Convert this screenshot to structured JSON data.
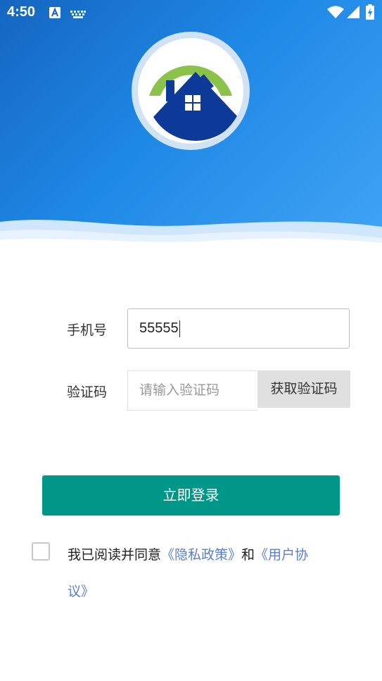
{
  "status_bar": {
    "time": "4:50",
    "icons": [
      "a-notification-icon",
      "keyboard-icon",
      "wifi-icon",
      "signal-icon",
      "battery-charging-icon"
    ]
  },
  "logo": {
    "name": "house-logo-icon",
    "colors": {
      "roof_arc": "#8bc34a",
      "house": "#0d3a99",
      "ring": "#cfe3f4"
    }
  },
  "form": {
    "phone_label": "手机号",
    "phone_value": "55555",
    "code_label": "验证码",
    "code_placeholder": "请输入验证码",
    "get_code_label": "获取验证码"
  },
  "login_button": "立即登录",
  "agreement": {
    "prefix": "我已阅读并同意",
    "privacy_link": "《隐私政策》",
    "conjunction": "和",
    "terms_link_part1": "《用户协",
    "terms_link_part2": "议》"
  },
  "colors": {
    "header_gradient_start": "#1565c0",
    "header_gradient_end": "#42a5f5",
    "primary_button": "#009688",
    "link": "#5b7fc7",
    "get_code_bg": "#e0e0e0"
  }
}
